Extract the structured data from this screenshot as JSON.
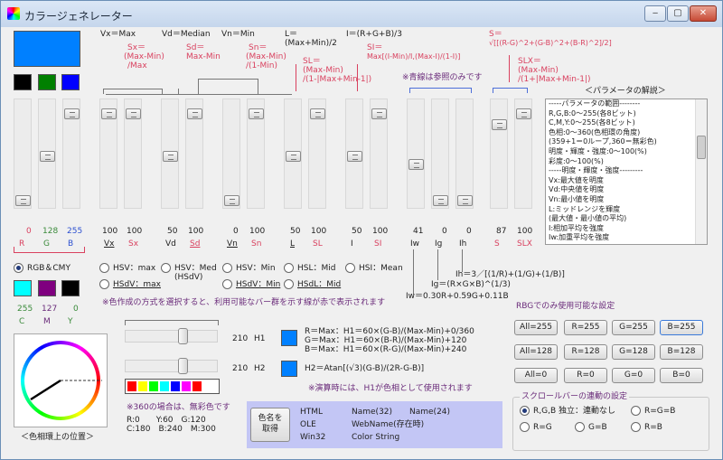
{
  "app": {
    "title": "カラージェネレーター"
  },
  "window_buttons": {
    "minimize": "‒",
    "maximize": "▢",
    "close": "✕"
  },
  "formulas": {
    "vx": "Vx＝Max",
    "vd": "Vd＝Median",
    "vn": "Vn＝Min",
    "l1": "L＝",
    "l2": "(Max+Min)/2",
    "i": "I＝(R+G+B)/3",
    "s": "S＝",
    "s_formula": "√[[(R-G)^2+(G-B)^2+(B-R)^2]/2]",
    "sx1": "Sx＝",
    "sx2": "(Max-Min)",
    "sx3": "/Max",
    "sd1": "Sd＝",
    "sd2": "Max-Min",
    "sn1": "Sn＝",
    "sn2": "(Max-Min)",
    "sn3": "/(1-Min)",
    "sl1": "SL＝",
    "sl2": "(Max-Min)",
    "sl3": "/(1-|Max+Min-1|)",
    "si1": "SI＝",
    "si2": "Max[(I-Min)/I,(Max-I)/(1-I)]",
    "slx1": "SLX＝",
    "slx2": "(Max-Min)",
    "slx3": "/(1+|Max+Min-1|)",
    "blue_note": "※青線は参照のみです"
  },
  "values": [
    "0",
    "128",
    "255",
    "100",
    "100",
    "50",
    "100",
    "0",
    "100",
    "50",
    "100",
    "50",
    "100",
    "41",
    "0",
    "0",
    "87",
    "100"
  ],
  "slider_labels": [
    "R",
    "G",
    "B",
    "Vx",
    "Sx",
    "Vd",
    "Sd",
    "Vn",
    "Sn",
    "L",
    "SL",
    "I",
    "SI",
    "Iw",
    "Ig",
    "Ih",
    "S",
    "SLX"
  ],
  "formula_ih": "Ih＝3／[(1/R)+(1/G)+(1/B)]",
  "formula_ig": "Ig＝(R×G×B)^(1/3)",
  "formula_iw": "Iw＝0.30R+0.59G+0.11B",
  "radios": [
    {
      "label": "RGB＆CMY"
    },
    {
      "label": "HSV：max"
    },
    {
      "label": "HSV：Med"
    },
    {
      "label": "HSV：Min"
    },
    {
      "label": "HSL：Mid"
    },
    {
      "label": "HSI：Mean"
    },
    {
      "label": "HSdV：max"
    },
    {
      "label": "HSdV：Min"
    },
    {
      "label": "HSdL：Mid"
    }
  ],
  "hsvmed_sub": "(HSdV)",
  "cmy": {
    "c": "255",
    "m": "127",
    "y": "0",
    "c_label": "C",
    "m_label": "M",
    "y_label": "Y"
  },
  "note_method": "※色作成の方式を選択すると、利用可能なバー群を示す線が赤で表示されます",
  "param": {
    "title": "＜パラメータの解説＞",
    "lines": [
      "-----パラメータの範囲--------",
      "R,G,B:0～255(各8ビット)",
      "C,M,Y:0～255(各8ビット)",
      "色相:0～360(色相環の角度)",
      "(359+1＝0ループ,360＝無彩色)",
      "明度・輝度・強度:0～100(%)",
      "彩度:0～100(%)",
      "-----明度・輝度・強度---------",
      "Vx:最大値を明度",
      "Vd:中央値を明度",
      "Vn:最小値を明度",
      "L:ミッドレンジを輝度",
      "(最大値・最小値の平均)",
      "I:相加平均を強度",
      "Iw:加重平均を強度"
    ]
  },
  "hue": {
    "caption": "＜色相環上の位置＞",
    "h1_value": "210",
    "h1_label": "H1",
    "h2_value": "210",
    "h2_label": "H2",
    "h1_formula": [
      "R＝Max：H1＝60×(G-B)/(Max-Min)+0/360",
      "G＝Max：H1＝60×(B-R)/(Max-Min)+120",
      "B＝Max：H1＝60×(R-G)/(Max-Min)+240"
    ],
    "h2_formula": "H2＝Atan[(√3)(G-B)/(2R-G-B)]",
    "note": "※演算時には、H1が色相として使用されます",
    "note360": "※360の場合は、無彩色です",
    "deg1": "R:0　　Y:60　G:120",
    "deg2": "C:180　B:240　M:300"
  },
  "getname": {
    "btn1": "色名を",
    "btn2": "取得",
    "html": "HTML",
    "ole": "OLE",
    "win32": "Win32",
    "name32": "Name(32)",
    "name24": "Name(24)",
    "webname": "WebName(存在時)",
    "colorstring": "Color String"
  },
  "rgbonly": {
    "title": "RBGでのみ使用可能な設定",
    "buttons": [
      [
        "All=255",
        "R=255",
        "G=255",
        "B=255"
      ],
      [
        "All=128",
        "R=128",
        "G=128",
        "B=128"
      ],
      [
        "All=0",
        "R=0",
        "G=0",
        "B=0"
      ]
    ]
  },
  "scroll": {
    "title": "スクロールバーの連動の設定",
    "options": [
      "R,G,B 独立：連動なし",
      "R=G=B",
      "R=G",
      "G=B",
      "R=B"
    ]
  },
  "colors": {
    "main": "#0080ff",
    "red": "#d9415f",
    "blue_line": "#4d6fd9"
  }
}
